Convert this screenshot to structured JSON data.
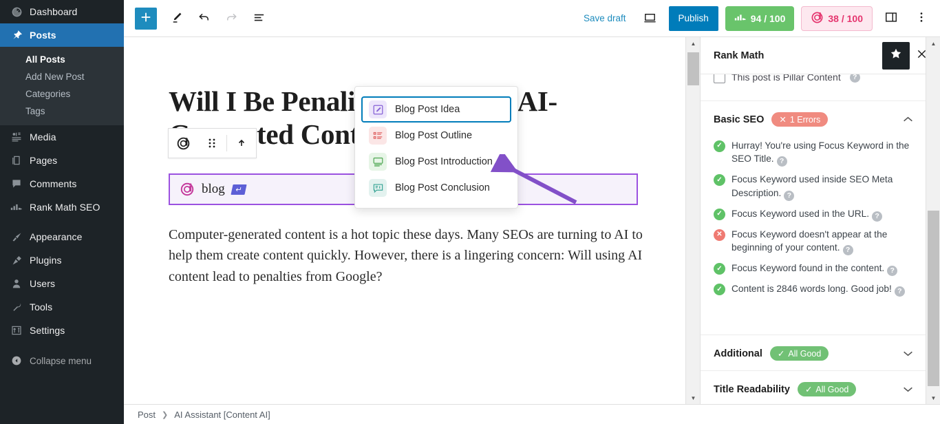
{
  "sidebar": {
    "items": [
      {
        "label": "Dashboard",
        "icon": "dashboard-icon",
        "current": false
      },
      {
        "label": "Posts",
        "icon": "pin-icon",
        "current": true
      },
      {
        "label": "Media",
        "icon": "media-icon",
        "current": false
      },
      {
        "label": "Pages",
        "icon": "pages-icon",
        "current": false
      },
      {
        "label": "Comments",
        "icon": "comments-icon",
        "current": false
      },
      {
        "label": "Rank Math SEO",
        "icon": "rankmath-icon",
        "current": false
      },
      {
        "label": "Appearance",
        "icon": "brush-icon",
        "current": false
      },
      {
        "label": "Plugins",
        "icon": "plug-icon",
        "current": false
      },
      {
        "label": "Users",
        "icon": "user-icon",
        "current": false
      },
      {
        "label": "Tools",
        "icon": "wrench-icon",
        "current": false
      },
      {
        "label": "Settings",
        "icon": "settings-icon",
        "current": false
      }
    ],
    "submenu": [
      {
        "label": "All Posts",
        "current": true
      },
      {
        "label": "Add New Post",
        "current": false
      },
      {
        "label": "Categories",
        "current": false
      },
      {
        "label": "Tags",
        "current": false
      }
    ],
    "collapse_label": "Collapse menu",
    "collapse_icon": "collapse-arrow-icon"
  },
  "header": {
    "add_block_icon": "plus-icon",
    "tools_icon": "pencil-icon",
    "undo_icon": "undo-arrow-icon",
    "redo_icon": "redo-arrow-icon",
    "list_view_icon": "list-view-icon",
    "save_draft_label": "Save draft",
    "preview_icon": "preview-laptop-icon",
    "publish_label": "Publish",
    "seo_score": "94 / 100",
    "seo_score_icon": "rankmath-seo-icon",
    "contentai_score": "38 / 100",
    "contentai_icon": "content-ai-icon",
    "settings_panel_icon": "sidebar-toggle-icon",
    "options_icon": "kebab-menu-icon",
    "accent_blue": "#007cba",
    "score_green": "#69c46b",
    "score_pink": "#e5366f"
  },
  "editor": {
    "post_title": "Will I Be Penalized for Using AI-Generated Content?",
    "paragraph": "Computer-generated content is a hot topic these days. Many SEOs are turning to AI to help them create content quickly. However, there is a lingering concern: Will using AI content lead to penalties from Google?",
    "block_toolbar": {
      "block_type_icon": "content-ai-block-icon",
      "drag_handle_icon": "drag-dots-icon"
    },
    "ai_block": {
      "icon": "content-ai-icon",
      "text": "blog",
      "enter_hint_icon": "enter-key-icon",
      "border_color": "#9b51e0",
      "background": "#f6f2fb"
    },
    "annotation_arrow_color": "#8250c8"
  },
  "command_menu": {
    "items": [
      {
        "label": "Blog Post Idea",
        "icon": "pencil-square-icon",
        "icon_bg": "#ede6fb",
        "icon_color": "#8763d6",
        "selected": true
      },
      {
        "label": "Blog Post Outline",
        "icon": "list-outline-icon",
        "icon_bg": "#fbe6e6",
        "icon_color": "#e06666",
        "selected": false
      },
      {
        "label": "Blog Post Introduction",
        "icon": "monitor-lines-icon",
        "icon_bg": "#e7f5e7",
        "icon_color": "#57ab5a",
        "selected": false
      },
      {
        "label": "Blog Post Conclusion",
        "icon": "speech-card-icon",
        "icon_bg": "#e3f2ef",
        "icon_color": "#3aa596",
        "selected": false
      }
    ],
    "selected_outline_color": "#007cba"
  },
  "rankmath": {
    "title": "Rank Math",
    "star_icon": "star-icon",
    "close_icon": "close-icon",
    "pillar_row_label": "This post is Pillar Content",
    "sections": [
      {
        "title": "Basic SEO",
        "badge": "1 Errors",
        "badge_type": "error",
        "badge_icon": "x-icon",
        "expanded": true,
        "chevron": "chevron-up-icon"
      },
      {
        "title": "Additional",
        "badge": "All Good",
        "badge_type": "ok",
        "badge_icon": "check-icon",
        "expanded": false,
        "chevron": "chevron-down-icon"
      },
      {
        "title": "Title Readability",
        "badge": "All Good",
        "badge_type": "ok",
        "badge_icon": "check-icon",
        "expanded": false,
        "chevron": "chevron-down-icon"
      }
    ],
    "basic_seo_checks": [
      {
        "status": "good",
        "text": "Hurray! You're using Focus Keyword in the SEO Title."
      },
      {
        "status": "good",
        "text": "Focus Keyword used inside SEO Meta Description."
      },
      {
        "status": "good",
        "text": "Focus Keyword used in the URL."
      },
      {
        "status": "bad",
        "text": "Focus Keyword doesn't appear at the beginning of your content."
      },
      {
        "status": "good",
        "text": "Focus Keyword found in the content."
      },
      {
        "status": "good",
        "text": "Content is 2846 words long. Good job!"
      }
    ],
    "help_icon": "question-mark-icon",
    "error_color": "#ef7a72",
    "good_color": "#5fc267"
  },
  "footer": {
    "breadcrumb": [
      "Post",
      "AI Assistant [Content AI]"
    ],
    "separator_icon": "chevron-right-icon"
  }
}
